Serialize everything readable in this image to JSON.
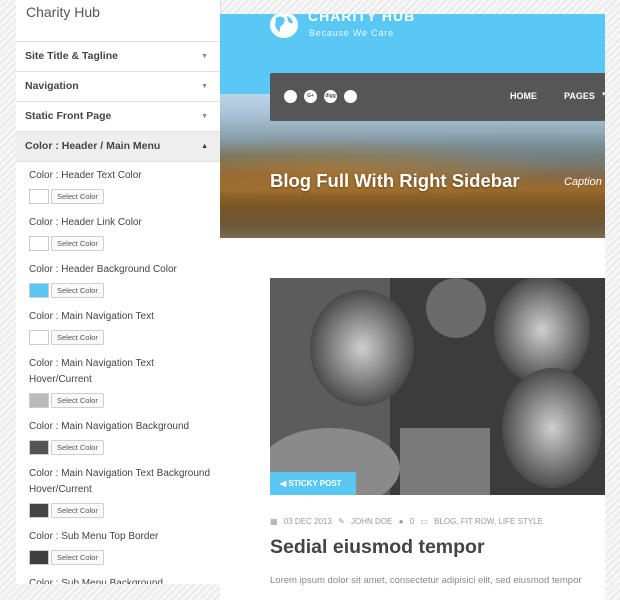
{
  "panel": {
    "title": "Charity Hub",
    "sections": [
      {
        "label": "Site Title & Tagline",
        "arrow": "▼"
      },
      {
        "label": "Navigation",
        "arrow": "▼"
      },
      {
        "label": "Static Front Page",
        "arrow": "▼"
      },
      {
        "label": "Color : Header / Main Menu",
        "arrow": "▲"
      }
    ],
    "select_label": "Select Color",
    "controls": [
      {
        "label": "Color : Header Text Color",
        "color": "#ffffff"
      },
      {
        "label": "Color : Header Link Color",
        "color": "#ffffff"
      },
      {
        "label": "Color : Header Background Color",
        "color": "#5ac8f5"
      },
      {
        "label": "Color : Main Navigation Text",
        "color": "#ffffff"
      },
      {
        "label": "Color : Main Navigation Text Hover/Current",
        "color": "#bbbbbb"
      },
      {
        "label": "Color : Main Navigation Background",
        "color": "#555555"
      },
      {
        "label": "Color : Main Navigation Text Background Hover/Current",
        "color": "#444444"
      },
      {
        "label": "Color : Sub Menu Top Border",
        "color": "#3f3f3f"
      },
      {
        "label": "Color : Sub Menu Background",
        "color": "#3a3a3a"
      }
    ]
  },
  "preview": {
    "site_title": "CHARITY HUB",
    "tagline": "Because We Care",
    "social_icons": [
      "sharethis-icon",
      "google-plus-icon",
      "digg-icon",
      "email-icon"
    ],
    "social_text": [
      "",
      "G+",
      "digg",
      ""
    ],
    "nav": {
      "home": "HOME",
      "pages": "PAGES",
      "caret": "▾"
    },
    "hero_title": "Blog Full With Right Sidebar",
    "hero_caption": "Caption for th",
    "sticky_label": "STICKY POST",
    "meta": {
      "date": "03 DEC 2013",
      "author": "JOHN DOE",
      "comments": "0",
      "categories": "BLOG, FIT ROW, LIFE STYLE"
    },
    "post_title": "Sedial eiusmod tempor",
    "excerpt": "Lorem ipsum dolor sit amet, consectetur adipisici elit, sed eiusmod tempor"
  },
  "colors": {
    "accent": "#5ac8f5",
    "nav_bg": "#565656"
  }
}
